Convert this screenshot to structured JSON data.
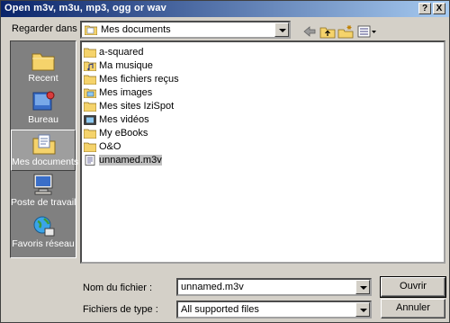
{
  "window": {
    "title": "Open m3v, m3u, mp3, ogg or wav",
    "help_button": "?",
    "close_button": "X"
  },
  "look_in": {
    "label": "Regarder dans :",
    "value": "Mes documents"
  },
  "toolbar": {
    "icons": [
      "back-arrow-icon",
      "up-folder-icon",
      "new-folder-icon",
      "view-menu-icon"
    ]
  },
  "places": [
    {
      "label": "Recent",
      "icon": "recent-folder-icon"
    },
    {
      "label": "Bureau",
      "icon": "desktop-icon"
    },
    {
      "label": "Mes documents",
      "icon": "my-documents-icon",
      "selected": true
    },
    {
      "label": "Poste de travail",
      "icon": "my-computer-icon"
    },
    {
      "label": "Favoris réseau",
      "icon": "network-places-icon"
    }
  ],
  "files": [
    {
      "name": "a-squared",
      "icon": "folder-icon"
    },
    {
      "name": "Ma musique",
      "icon": "music-folder-icon"
    },
    {
      "name": "Mes fichiers reçus",
      "icon": "folder-icon"
    },
    {
      "name": "Mes images",
      "icon": "pictures-folder-icon"
    },
    {
      "name": "Mes sites IziSpot",
      "icon": "folder-icon"
    },
    {
      "name": "Mes vidéos",
      "icon": "video-folder-icon"
    },
    {
      "name": "My eBooks",
      "icon": "folder-icon"
    },
    {
      "name": "O&O",
      "icon": "folder-icon"
    },
    {
      "name": "unnamed.m3v",
      "icon": "file-icon",
      "selected": true
    }
  ],
  "filename": {
    "label": "Nom du fichier :",
    "value": "unnamed.m3v"
  },
  "filetype": {
    "label": "Fichiers de type :",
    "value": "All supported files"
  },
  "buttons": {
    "open": "Ouvrir",
    "cancel": "Annuler"
  },
  "colors": {
    "titlebar_start": "#0a246a",
    "titlebar_end": "#a6caf0",
    "face": "#d4d0c8",
    "places_bg": "#808080",
    "folder": "#f5d36b"
  }
}
